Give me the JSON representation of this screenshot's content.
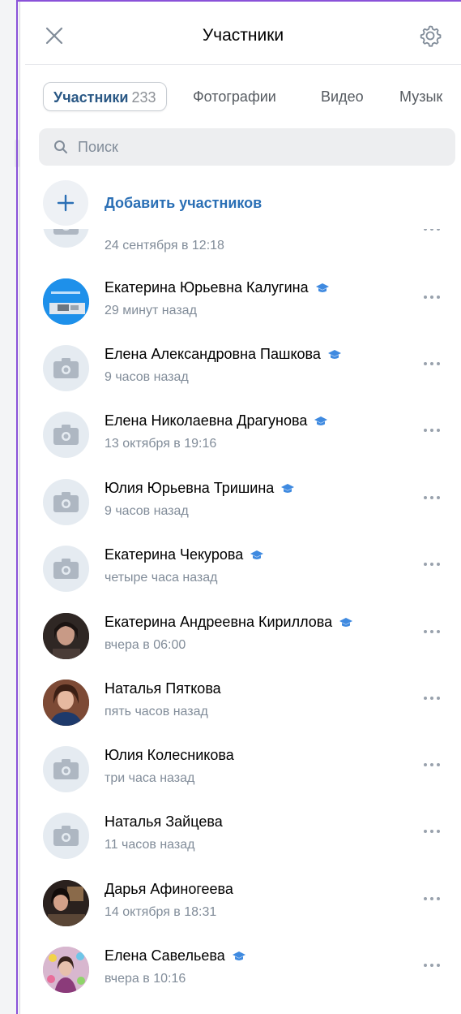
{
  "header": {
    "title": "Участники",
    "close_icon": "close-icon",
    "settings_icon": "gear-icon"
  },
  "tabs": [
    {
      "label": "Участники",
      "count": "233",
      "active": true
    },
    {
      "label": "Фотографии"
    },
    {
      "label": "Видео"
    },
    {
      "label": "Музык"
    }
  ],
  "search": {
    "placeholder": "Поиск",
    "value": "",
    "icon": "search-icon"
  },
  "add_members": {
    "label": "Добавить участников",
    "icon": "plus-icon"
  },
  "members": [
    {
      "name": "",
      "time": "24 сентября в 12:18",
      "avatar": "camera-icon",
      "edu": false
    },
    {
      "name": "Екатерина Юрьевна Калугина",
      "time": "29 минут назад",
      "avatar": "photo",
      "edu": true
    },
    {
      "name": "Елена Александровна Пашкова",
      "time": "9 часов назад",
      "avatar": "camera-icon",
      "edu": true
    },
    {
      "name": "Елена Николаевна Драгунова",
      "time": "13 октября в 19:16",
      "avatar": "camera-icon",
      "edu": true
    },
    {
      "name": "Юлия Юрьевна Тришина",
      "time": "9 часов назад",
      "avatar": "camera-icon",
      "edu": true
    },
    {
      "name": "Екатерина Чекурова",
      "time": "четыре часа назад",
      "avatar": "camera-icon",
      "edu": true
    },
    {
      "name": "Екатерина Андреевна Кириллова",
      "time": "вчера в 06:00",
      "avatar": "photo",
      "edu": true
    },
    {
      "name": "Наталья Пяткова",
      "time": "пять часов назад",
      "avatar": "photo",
      "edu": false
    },
    {
      "name": "Юлия Колесникова",
      "time": "три часа назад",
      "avatar": "camera-icon",
      "edu": false
    },
    {
      "name": "Наталья Зайцева",
      "time": "11 часов назад",
      "avatar": "camera-icon",
      "edu": false
    },
    {
      "name": "Дарья Афиногеева",
      "time": "14 октября в 18:31",
      "avatar": "photo",
      "edu": false
    },
    {
      "name": "Елена Савельева",
      "time": "вчера в 10:16",
      "avatar": "photo",
      "edu": true
    }
  ],
  "colors": {
    "accent": "#2a6fb5",
    "edu_badge": "#3f8ae0",
    "frame_accent": "#8a52d9",
    "secondary_text": "#818c99"
  }
}
